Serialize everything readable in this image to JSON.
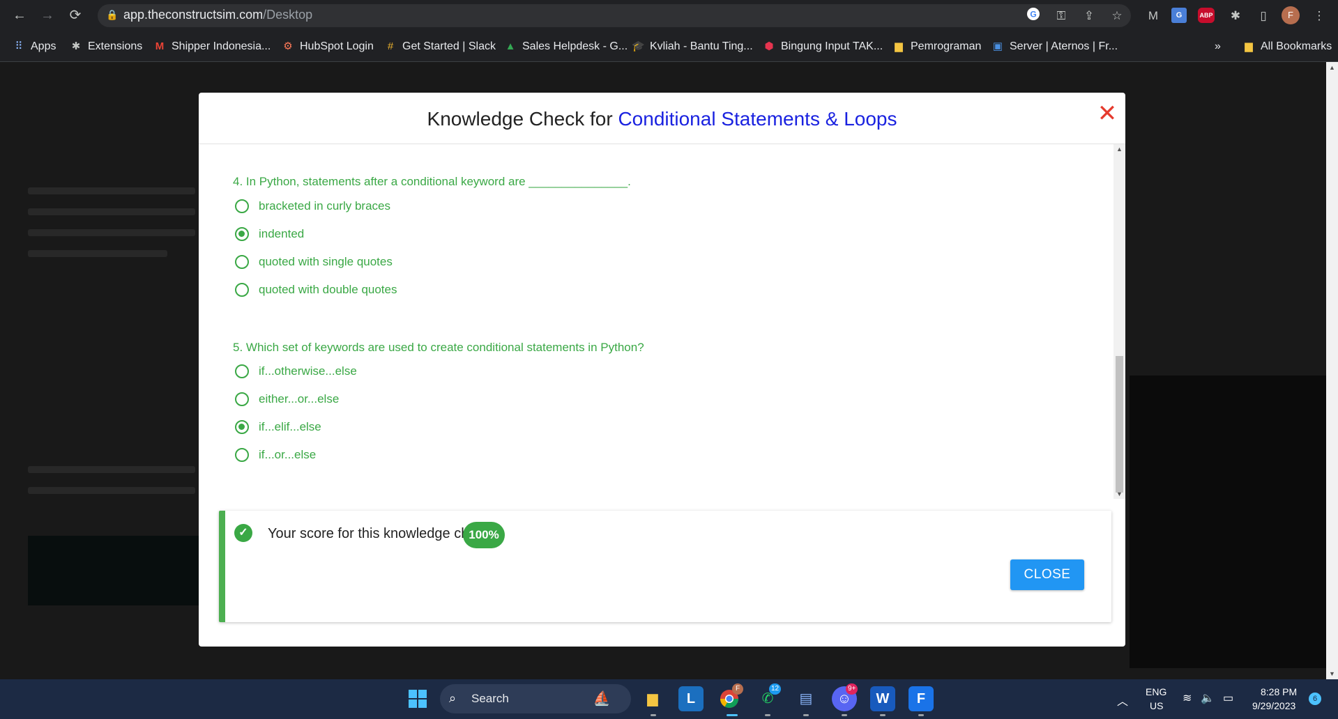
{
  "browser": {
    "url_domain": "app.theconstructsim.com",
    "url_path": "/Desktop",
    "profile_initial": "F",
    "abp_label": "ABP",
    "bookmarks": [
      {
        "label": "Apps",
        "icon": "apps-grid-icon"
      },
      {
        "label": "Extensions",
        "icon": "puzzle-icon"
      },
      {
        "label": "Shipper Indonesia...",
        "icon": "gmail-icon"
      },
      {
        "label": "HubSpot Login",
        "icon": "hubspot-icon"
      },
      {
        "label": "Get Started | Slack",
        "icon": "slack-icon"
      },
      {
        "label": "Sales Helpdesk - G...",
        "icon": "google-drive-icon"
      },
      {
        "label": "Kvliah - Bantu Ting...",
        "icon": "graduation-cap-icon"
      },
      {
        "label": "Bingung Input TAK...",
        "icon": "hexagon-icon"
      },
      {
        "label": "Pemrograman",
        "icon": "folder-icon"
      },
      {
        "label": "Server | Aternos | Fr...",
        "icon": "aternos-icon"
      }
    ],
    "overflow_label": "»",
    "all_bookmarks_label": "All Bookmarks"
  },
  "modal": {
    "title_prefix": "Knowledge Check for ",
    "title_highlight": "Conditional Statements & Loops",
    "questions": [
      {
        "text": "4. In Python, statements after a conditional keyword are _______________.",
        "options": [
          {
            "label": "bracketed in curly braces",
            "selected": false
          },
          {
            "label": "indented",
            "selected": true
          },
          {
            "label": "quoted with single quotes",
            "selected": false
          },
          {
            "label": "quoted with double quotes",
            "selected": false
          }
        ]
      },
      {
        "text": "5. Which set of keywords are used to create conditional statements in Python?",
        "options": [
          {
            "label": "if...otherwise...else",
            "selected": false
          },
          {
            "label": "either...or...else",
            "selected": false
          },
          {
            "label": "if...elif...else",
            "selected": true
          },
          {
            "label": "if...or...else",
            "selected": false
          }
        ]
      }
    ],
    "score_label": "Your score for this knowledge check:",
    "score_value": "100%",
    "close_button": "CLOSE"
  },
  "taskbar": {
    "search_label": "Search",
    "chrome_badge": "F",
    "whatsapp_badge": "12",
    "discord_badge": "9+",
    "lang": "ENG",
    "region": "US",
    "time": "8:28 PM",
    "date": "9/29/2023",
    "notifications": "6"
  },
  "colors": {
    "accent_green": "#3aa845",
    "title_blue": "#1a22e0",
    "close_red": "#e53b2e",
    "button_blue": "#2196f3"
  }
}
